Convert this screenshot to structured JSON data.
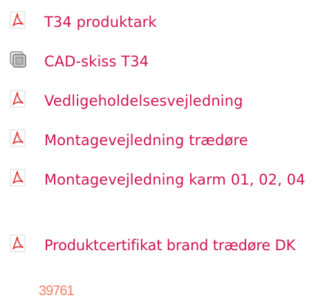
{
  "documents": [
    {
      "label": "T34 produktark",
      "icon": "pdf-icon"
    },
    {
      "label": "CAD-skiss T34",
      "icon": "cad-icon"
    },
    {
      "label": "Vedligeholdelsesvejledning",
      "icon": "pdf-icon"
    },
    {
      "label": "Montagevejledning trædøre",
      "icon": "pdf-icon"
    },
    {
      "label": "Montagevejledning karm 01, 02, 04",
      "icon": "pdf-icon"
    },
    {
      "label": "Produktcertifikat brand trædøre DK",
      "icon": "pdf-icon"
    }
  ],
  "footer": {
    "number": "39761"
  },
  "colors": {
    "link": "#d1164f",
    "pdf_accent": "#e0403c",
    "footer": "#f08060"
  }
}
